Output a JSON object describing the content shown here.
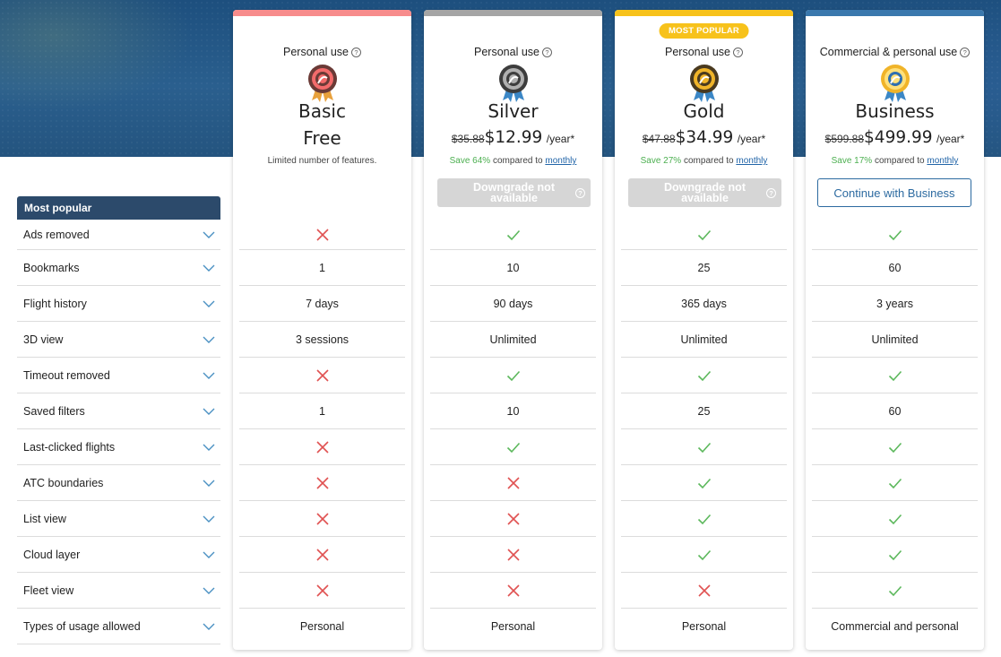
{
  "colors": {
    "basic": "#f78c8c",
    "silver": "#a5a5a5",
    "gold": "#f7c21b",
    "business": "#3a78ad",
    "check": "#5cb85c",
    "cross": "#e05252"
  },
  "features": {
    "header": "Most popular",
    "items": [
      "Ads removed",
      "Bookmarks",
      "Flight history",
      "3D view",
      "Timeout removed",
      "Saved filters",
      "Last-clicked flights",
      "ATC boundaries",
      "List view",
      "Cloud layer",
      "Fleet view",
      "Types of usage allowed"
    ]
  },
  "plans": [
    {
      "use": "Personal use",
      "name": "Basic",
      "free": "Free",
      "limited": "Limited number of features.",
      "medal_icon": "basic-medal-icon",
      "cells": [
        "cross",
        "1",
        "7 days",
        "3 sessions",
        "cross",
        "1",
        "cross",
        "cross",
        "cross",
        "cross",
        "cross",
        "Personal"
      ]
    },
    {
      "use": "Personal use",
      "name": "Silver",
      "old_price": "$35.88",
      "price": "$12.99",
      "per": "/year*",
      "save": "Save 64%",
      "compared": "compared to",
      "monthly": "monthly",
      "button": "Downgrade not available",
      "medal_icon": "silver-medal-icon",
      "cells": [
        "check",
        "10",
        "90 days",
        "Unlimited",
        "check",
        "10",
        "check",
        "cross",
        "cross",
        "cross",
        "cross",
        "Personal"
      ]
    },
    {
      "badge": "MOST POPULAR",
      "use": "Personal use",
      "name": "Gold",
      "old_price": "$47.88",
      "price": "$34.99",
      "per": "/year*",
      "save": "Save 27%",
      "compared": "compared to",
      "monthly": "monthly",
      "button": "Downgrade not available",
      "medal_icon": "gold-medal-icon",
      "cells": [
        "check",
        "25",
        "365 days",
        "Unlimited",
        "check",
        "25",
        "check",
        "check",
        "check",
        "check",
        "cross",
        "Personal"
      ]
    },
    {
      "use": "Commercial & personal use",
      "name": "Business",
      "old_price": "$599.88",
      "price": "$499.99",
      "per": "/year*",
      "save": "Save 17%",
      "compared": "compared to",
      "monthly": "monthly",
      "button": "Continue with Business",
      "medal_icon": "business-medal-icon",
      "cells": [
        "check",
        "60",
        "3 years",
        "Unlimited",
        "check",
        "60",
        "check",
        "check",
        "check",
        "check",
        "check",
        "Commercial and personal"
      ]
    }
  ]
}
